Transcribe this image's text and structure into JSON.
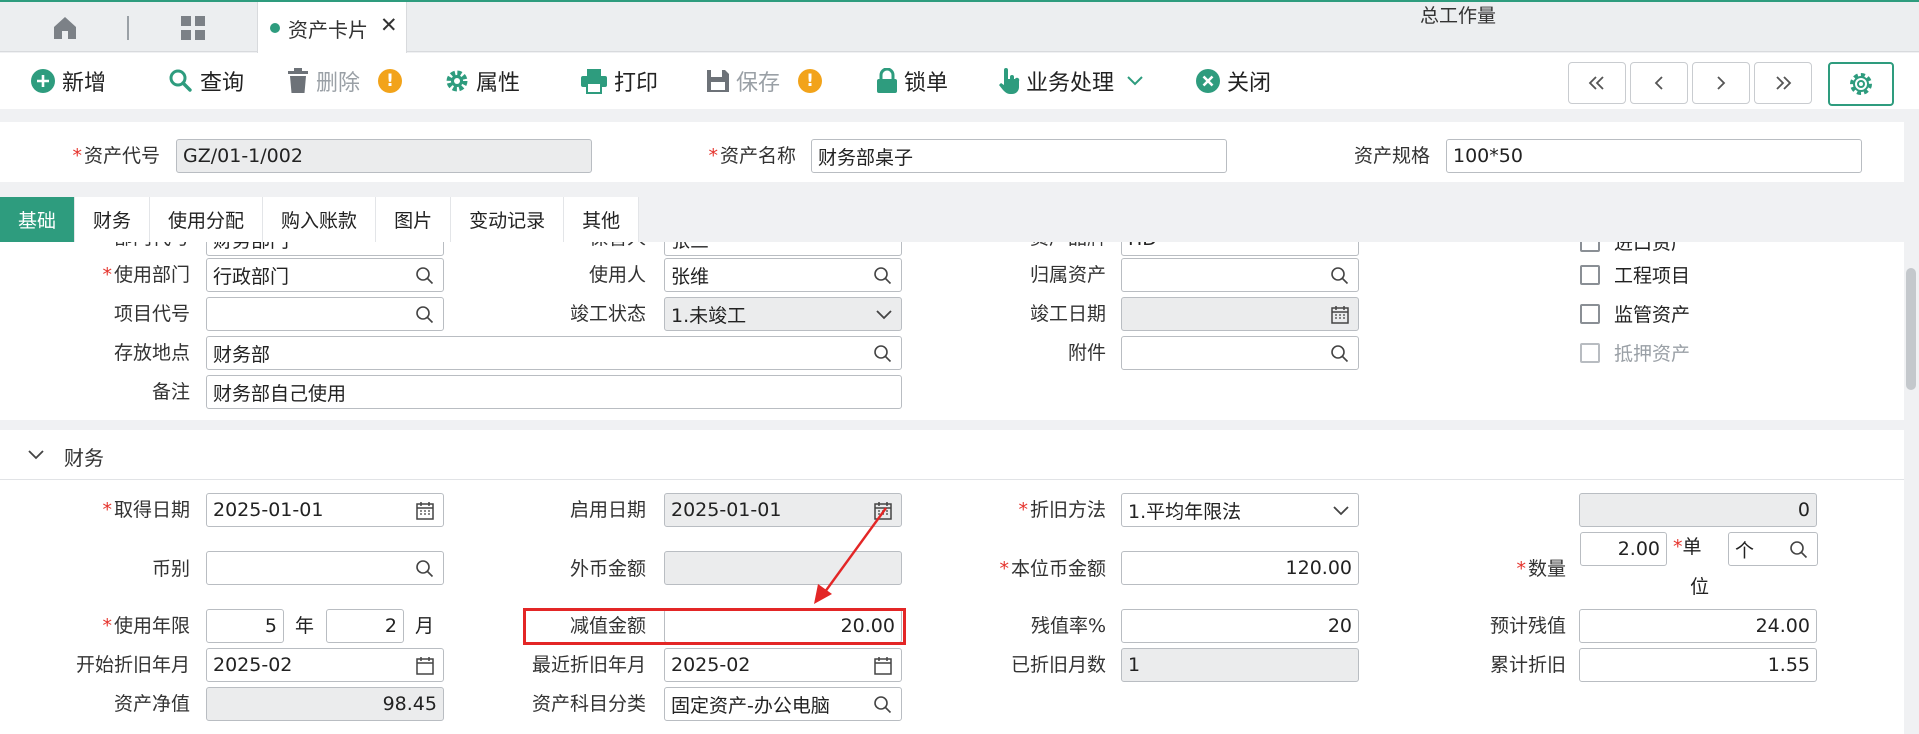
{
  "tab_strip": {
    "home_icon": "home-icon",
    "grid_icon": "grid-icon",
    "active_tab": {
      "label": "资产卡片",
      "close": "✕"
    }
  },
  "toolbar": {
    "add": "新增",
    "query": "查询",
    "delete": "删除",
    "delete_warning": "!",
    "attributes": "属性",
    "print": "打印",
    "save": "保存",
    "save_warning": "!",
    "lock": "锁单",
    "business": "业务处理",
    "close": "关闭"
  },
  "header": {
    "asset_code": {
      "label": "资产代号",
      "value": "GZ/01-1/002"
    },
    "asset_name": {
      "label": "资产名称",
      "value": "财务部桌子"
    },
    "asset_spec": {
      "label": "资产规格",
      "value": "100*50"
    }
  },
  "tabs": [
    "基础",
    "财务",
    "使用分配",
    "购入账款",
    "图片",
    "变动记录",
    "其他"
  ],
  "basic": {
    "partial_row": {
      "dept_code_label": "部门代号",
      "dept_code_value": "财务部门",
      "keeper_label": "保管人",
      "keeper_value": "张三",
      "brand_label": "资产品牌",
      "brand_value": "HD",
      "import_label": "进口资产"
    },
    "use_dept": {
      "label": "使用部门",
      "value": "行政部门"
    },
    "user": {
      "label": "使用人",
      "value": "张维"
    },
    "parent_asset": {
      "label": "归属资产",
      "value": ""
    },
    "project_code": {
      "label": "项目代号",
      "value": ""
    },
    "completion_status": {
      "label": "竣工状态",
      "value": "1.未竣工"
    },
    "completion_date": {
      "label": "竣工日期",
      "value": ""
    },
    "location": {
      "label": "存放地点",
      "value": "财务部"
    },
    "attachment": {
      "label": "附件",
      "value": ""
    },
    "remark": {
      "label": "备注",
      "value": "财务部自己使用"
    },
    "checkboxes": {
      "engineering": "工程项目",
      "supervised": "监管资产",
      "mortgage": "抵押资产"
    }
  },
  "finance": {
    "section_title": "财务",
    "acquire_date": {
      "label": "取得日期",
      "value": "2025-01-01"
    },
    "enable_date": {
      "label": "启用日期",
      "value": "2025-01-01"
    },
    "depr_method": {
      "label": "折旧方法",
      "value": "1.平均年限法"
    },
    "total_workload": {
      "label": "总工作量",
      "value": "0"
    },
    "currency": {
      "label": "币别",
      "value": ""
    },
    "foreign_amount": {
      "label": "外币金额",
      "value": ""
    },
    "local_amount": {
      "label": "本位币金额",
      "value": "120.00"
    },
    "quantity": {
      "label": "数量",
      "value": "2.00",
      "unit_label_1": "单",
      "unit_label_2": "位",
      "unit_value": "个"
    },
    "use_life": {
      "label": "使用年限",
      "years": "5",
      "years_unit": "年",
      "months": "2",
      "months_unit": "月"
    },
    "impairment": {
      "label": "减值金额",
      "value": "20.00"
    },
    "salvage_rate": {
      "label": "残值率%",
      "value": "20"
    },
    "expected_salvage": {
      "label": "预计残值",
      "value": "24.00"
    },
    "start_depr": {
      "label": "开始折旧年月",
      "value": "2025-02"
    },
    "recent_depr": {
      "label": "最近折旧年月",
      "value": "2025-02"
    },
    "depr_months": {
      "label": "已折旧月数",
      "value": "1"
    },
    "accum_depr": {
      "label": "累计折旧",
      "value": "1.55"
    },
    "net_value": {
      "label": "资产净值",
      "value": "98.45"
    },
    "account_class": {
      "label": "资产科目分类",
      "value": "固定资产-办公电脑"
    }
  },
  "colors": {
    "accent": "#2e9c7e",
    "required": "#e5332c",
    "highlight": "#e32626",
    "warning": "#f2a31a"
  }
}
